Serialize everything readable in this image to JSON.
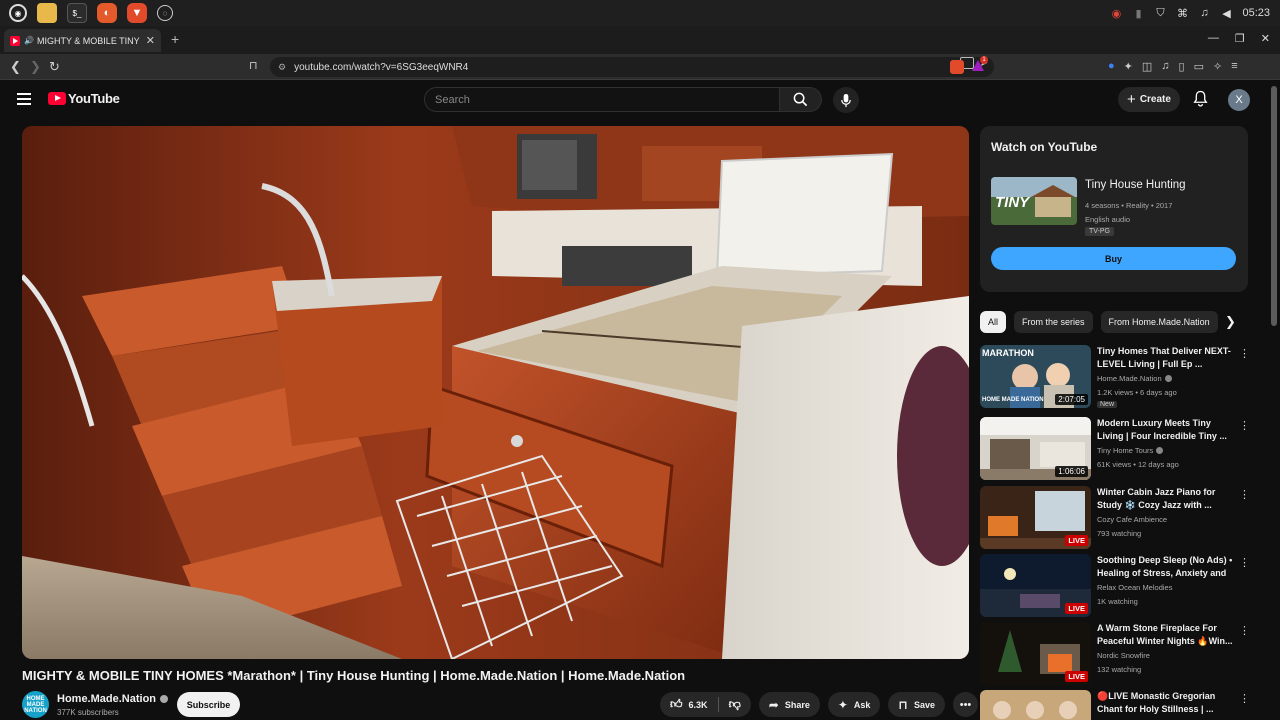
{
  "taskbar": {
    "clock": "05:23"
  },
  "browser": {
    "tab_title": "MIGHTY & MOBILE TINY HO",
    "url": "youtube.com/watch?v=6SG3eeqWNR4",
    "badge_count": "1"
  },
  "yt": {
    "logo_text": "YouTube",
    "search_placeholder": "Search",
    "create_label": "Create",
    "avatar_letter": "X"
  },
  "video": {
    "title": "MIGHTY & MOBILE TINY HOMES *Marathon* | Tiny House Hunting | Home.Made.Nation | Home.Made.Nation",
    "channel": "Home.Made.Nation",
    "channel_avatar_text": "HOME MADE NATION",
    "subscribers": "377K subscribers",
    "subscribe_label": "Subscribe",
    "likes": "6.3K",
    "share_label": "Share",
    "ask_label": "Ask",
    "save_label": "Save"
  },
  "watch_card": {
    "heading": "Watch on YouTube",
    "show_title": "Tiny House Hunting",
    "thumb_text": "TINY",
    "meta_line": "4 seasons • Reality • 2017",
    "audio": "English audio",
    "rating": "TV-PG",
    "buy_label": "Buy"
  },
  "chips": [
    "All",
    "From the series",
    "From Home.Made.Nation"
  ],
  "recommendations": [
    {
      "title": "Tiny Homes That Deliver NEXT-LEVEL Living | Full Ep ...",
      "channel": "Home.Made.Nation",
      "verified": true,
      "stats": "1.2K views • 6 days ago",
      "badge": "2:07:05",
      "extra": "New",
      "thumb_text": "MARATHON",
      "thumb_text2": "HOME MADE NATION"
    },
    {
      "title": "Modern Luxury Meets Tiny Living | Four Incredible Tiny ...",
      "channel": "Tiny Home Tours",
      "verified": true,
      "stats": "61K views • 12 days ago",
      "badge": "1:06:06"
    },
    {
      "title": "Winter Cabin Jazz Piano for Study ❄️ Cozy Jazz with ...",
      "channel": "Cozy Cafe Ambience",
      "stats": "793 watching",
      "badge": "LIVE"
    },
    {
      "title": "Soothing Deep Sleep (No Ads) • Healing of Stress, Anxiety and ...",
      "channel": "Relax Ocean Melodies",
      "stats": "1K watching",
      "badge": "LIVE"
    },
    {
      "title": "A Warm Stone Fireplace For Peaceful Winter Nights 🔥Win...",
      "channel": "Nordic Snowfire",
      "stats": "132 watching",
      "badge": "LIVE"
    },
    {
      "title": "🔴LIVE Monastic Gregorian Chant for Holy Stillness | ...",
      "channel": "",
      "stats": "",
      "badge": ""
    }
  ]
}
